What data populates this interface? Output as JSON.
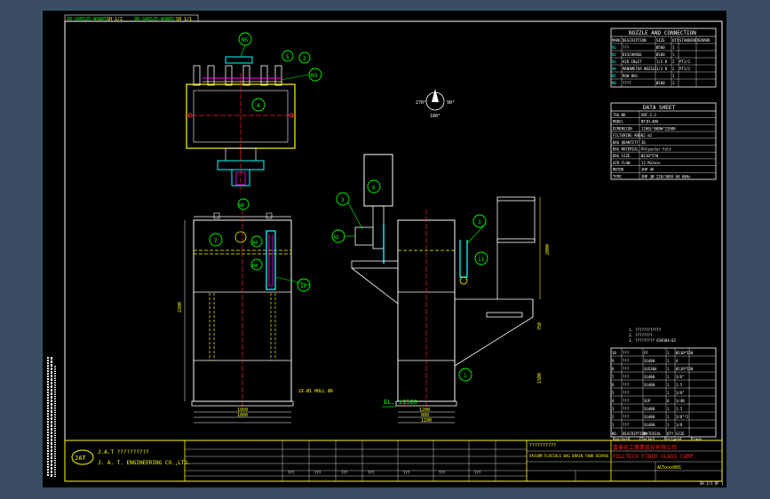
{
  "header": {
    "dwg_no_left": "90-S06525-WSW05",
    "sheet_left": "SH 1/1",
    "dwg_no_right": "90-S06525-WSW05",
    "sheet_right": "SH 1/1"
  },
  "nozzle_table": {
    "title": "NOZZLE AND CONNECTION",
    "headers": [
      "MARK",
      "DESCRIPTION",
      "SIZE",
      "QTY",
      "STANDARD",
      "REMARK"
    ],
    "rows": [
      [
        "N1",
        "???",
        "Ø500",
        "1",
        "",
        ""
      ],
      [
        "N2",
        "DISCHARGE",
        "Ø100",
        "1",
        "",
        ""
      ],
      [
        "N3",
        "AIR INLET",
        "1/2 B",
        "2",
        "PT1/2",
        ""
      ],
      [
        "N4",
        "MANOMETER NOZZLE",
        "1/2 B",
        "2",
        "PT1/2",
        ""
      ],
      [
        "N5",
        "RAW BAG",
        "",
        "1",
        "",
        ""
      ],
      [
        "N6",
        "????",
        "Ø100",
        "1",
        "",
        ""
      ]
    ]
  },
  "data_sheet": {
    "title": "DATA SHEET",
    "rows": [
      [
        "TAG NO",
        "VBF-1-3"
      ],
      [
        "MODEL",
        "BF3H-4BV"
      ],
      [
        "DIMENSION",
        "1200L*800W*2200H"
      ],
      [
        "FILTERING AREA",
        "12 m2"
      ],
      [
        "BAG QUANTITY",
        "36"
      ],
      [
        "BAG MATERIAL",
        "Polyester Felt"
      ],
      [
        "BAG SIZE",
        "Ø130*550"
      ],
      [
        "AIR FLOW",
        "12 M3/min"
      ],
      [
        "MOTOR",
        "3HP 4P"
      ],
      [
        "TYPE",
        "3HP 3Ø 220/380V 60 60Hz"
      ]
    ]
  },
  "notes": [
    "1. ????????????",
    "2. ????????",
    "3. ????????? 65#304-02"
  ],
  "parts_list": {
    "headers": [
      "NO.",
      "DESCRIPTION",
      "MATERIAL",
      "QTY",
      "SIZE"
    ],
    "rows": [
      [
        "10",
        "???",
        "FF",
        "1",
        "Ø130*550"
      ],
      [
        "9",
        "???",
        "SS400",
        "1",
        "A"
      ],
      [
        "8",
        "???",
        "SUS304",
        "1",
        "Ø130*550"
      ],
      [
        "7",
        "???",
        "SS400",
        "1",
        "3/8\""
      ],
      [
        "6",
        "???",
        "SS400",
        "1",
        "1.5"
      ],
      [
        "5",
        "???",
        "",
        "1",
        "3/8\""
      ],
      [
        "4",
        "???",
        "SGP",
        "6",
        "3/4B"
      ],
      [
        "3",
        "???",
        "SS400",
        "1",
        "1.5"
      ],
      [
        "2",
        "???",
        "SS400",
        "1",
        "3/8\"*2"
      ],
      [
        "1",
        "???",
        "SS400",
        "1",
        "1/8"
      ]
    ]
  },
  "title_block": {
    "company_cn": "J.A.T ??????????",
    "company_en": "J. A. T. ENGINEERING  CO.,LTD.",
    "logo": "JAT",
    "drawing_title": "??????????",
    "drawing_desc": "VACUUM FLOCCULE BAG DRAIN TANK 6CHYNS",
    "corp_cn": "富泰化工實業股份有限公司",
    "corp_en": "FULLTECH FIBER GLASS CORP.",
    "dwg_no": "AC5xxx001",
    "rev_cells": [
      "???",
      "???",
      "???",
      "???",
      "???",
      "???",
      "???"
    ],
    "approval": [
      "Approved",
      "Checked",
      "Designed",
      "Drawn"
    ]
  },
  "labels": {
    "callouts": [
      "N5",
      "5",
      "2",
      "N3",
      "4",
      "N8",
      "7",
      "N4",
      "N4",
      "10",
      "3",
      "N1",
      "6",
      "3",
      "11",
      "1"
    ],
    "elevation": "EL. ±1520",
    "nozzle_note": "2X-Ø1 HOLL Ø6",
    "north_angles": [
      "270°",
      "90°",
      "180°"
    ],
    "dims_front": [
      "2200",
      "1950",
      "1800"
    ],
    "dims_side": [
      "1200",
      "800",
      "750",
      "1500",
      "1100"
    ],
    "right_margin": "2000",
    "bottom_right": "SH 1/1 OF 1"
  },
  "colors": {
    "background": "#000000",
    "frame": "#ffffff",
    "yellow": "#ffff00",
    "green": "#00ff00",
    "cyan": "#00ffff",
    "red": "#ff2020",
    "magenta": "#ff00ff",
    "outer": "#3a4d63"
  }
}
